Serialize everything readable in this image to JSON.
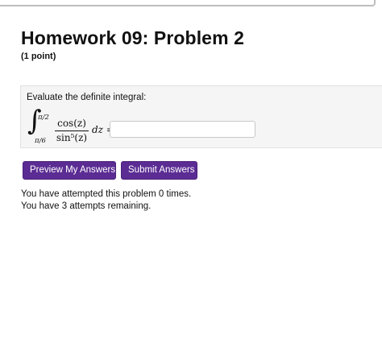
{
  "header": {
    "title": "Homework 09: Problem 2",
    "points": "(1 point)"
  },
  "problem": {
    "prompt": "Evaluate the definite integral:",
    "integral": {
      "upper_limit": "π/2",
      "lower_limit": "π/6",
      "numerator": "cos(z)",
      "denominator": "sin⁵(z)",
      "differential": "dz ="
    },
    "answer": {
      "value": "",
      "placeholder": ""
    }
  },
  "actions": {
    "preview_label": "Preview My Answers",
    "submit_label": "Submit Answers"
  },
  "status": {
    "attempted": "You have attempted this problem 0 times.",
    "remaining": "You have 3 attempts remaining."
  }
}
